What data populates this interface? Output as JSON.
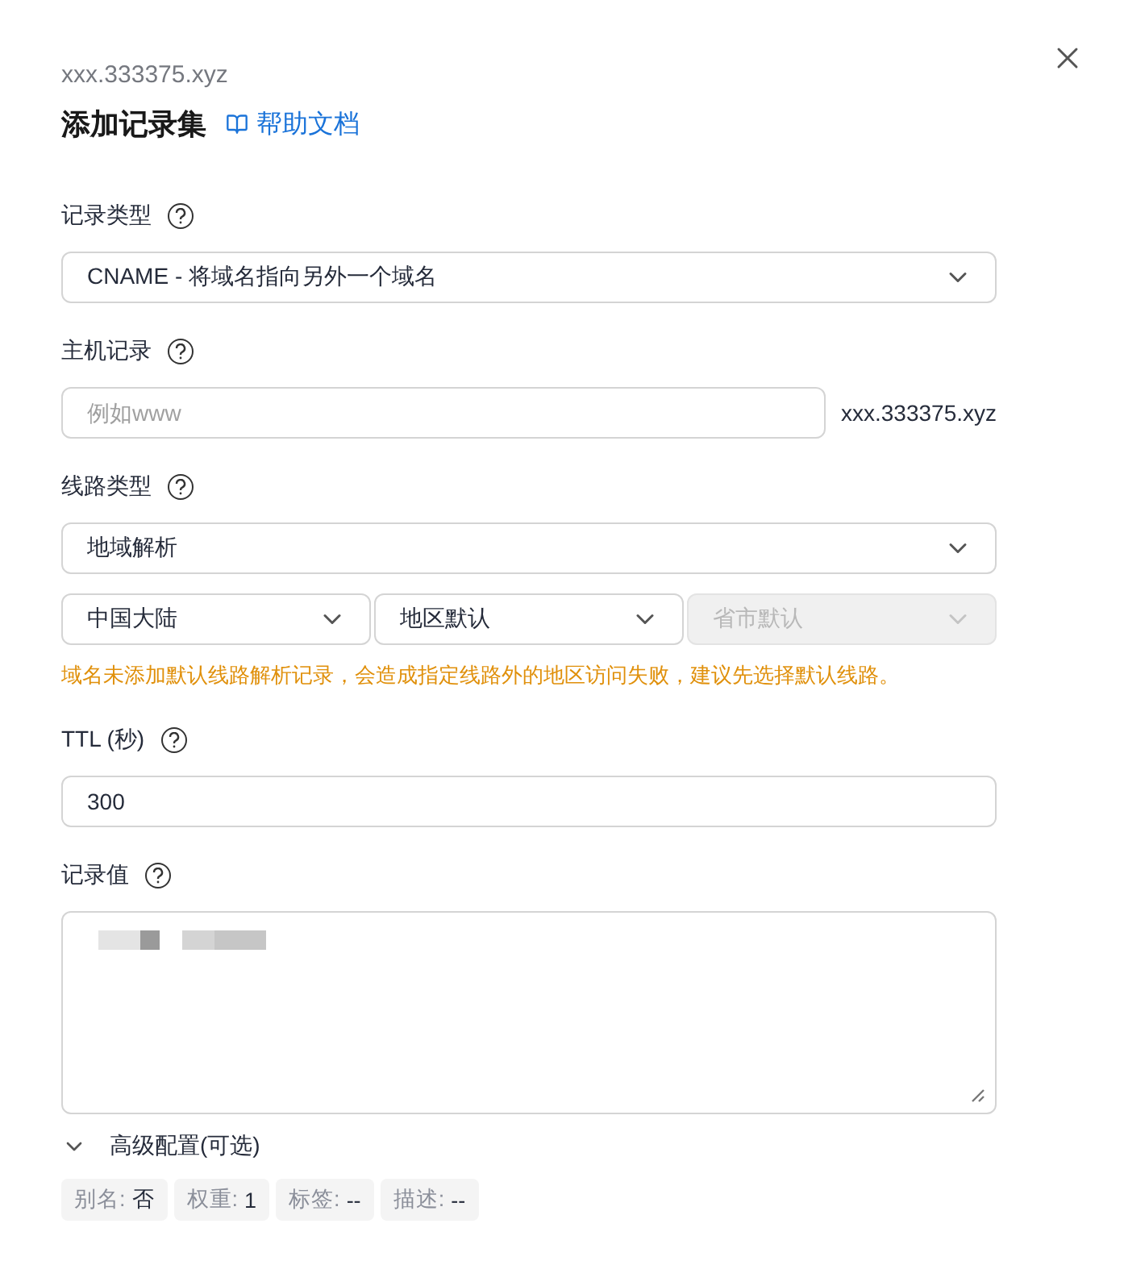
{
  "domain": "xxx.333375.xyz",
  "title": "添加记录集",
  "help_link": "帮助文档",
  "fields": [
    {
      "kind": "select",
      "label": "记录类型",
      "value": "CNAME - 将域名指向另外一个域名"
    },
    {
      "kind": "input",
      "label": "主机记录",
      "placeholder": "例如www",
      "suffix": "xxx.333375.xyz"
    },
    {
      "kind": "line",
      "label": "线路类型",
      "value": "地域解析",
      "sub_selects": [
        {
          "value": "中国大陆",
          "disabled": false
        },
        {
          "value": "地区默认",
          "disabled": false
        },
        {
          "placeholder": "省市默认",
          "disabled": true
        }
      ],
      "warning": "域名未添加默认线路解析记录，会造成指定线路外的地区访问失败，建议先选择默认线路。"
    },
    {
      "kind": "input",
      "label": "TTL (秒)",
      "value": "300"
    },
    {
      "kind": "textarea",
      "label": "记录值"
    }
  ],
  "advanced": {
    "label": "高级配置(可选)",
    "expanded": false,
    "tags": [
      {
        "label": "别名:",
        "value": "否"
      },
      {
        "label": "权重:",
        "value": "1"
      },
      {
        "label": "标签:",
        "value": "--"
      },
      {
        "label": "描述:",
        "value": "--"
      }
    ]
  }
}
